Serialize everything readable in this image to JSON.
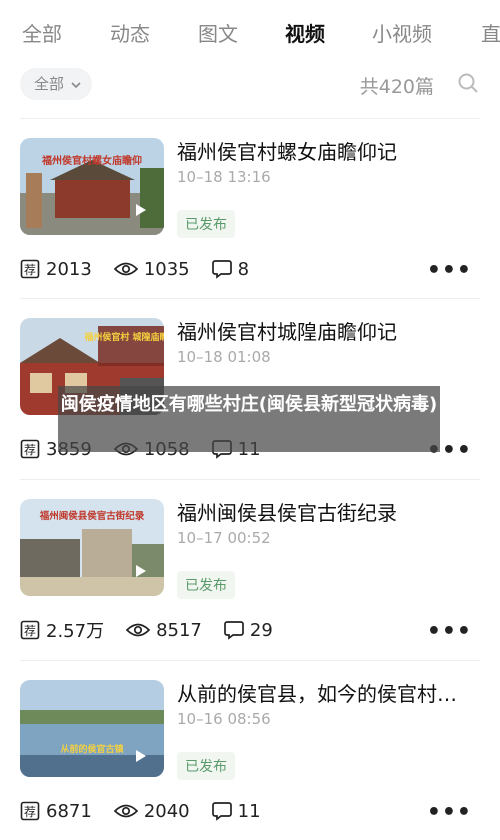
{
  "tabs": [
    {
      "label": "全部"
    },
    {
      "label": "动态"
    },
    {
      "label": "图文"
    },
    {
      "label": "视频"
    },
    {
      "label": "小视频"
    },
    {
      "label": "直"
    }
  ],
  "active_tab": "视频",
  "filter": {
    "label": "全部"
  },
  "total": {
    "label": "共420篇"
  },
  "videos": [
    {
      "title": "福州侯官村螺女庙瞻仰记",
      "date": "10–18 13:16",
      "badge": "已发布",
      "rec": "2013",
      "views": "1035",
      "comments": "8",
      "thumb_caption": "福州侯官村螺女庙瞻仰"
    },
    {
      "title": "福州侯官村城隍庙瞻仰记",
      "date": "10–18 01:08",
      "badge": "",
      "rec": "3859",
      "views": "1058",
      "comments": "11",
      "thumb_caption": "福州侯官村 城隍庙瞻仰"
    },
    {
      "title": "福州闽侯县侯官古街纪录",
      "date": "10–17 00:52",
      "badge": "已发布",
      "rec": "2.57万",
      "views": "8517",
      "comments": "29",
      "thumb_caption": "福州闽侯县侯官古街纪录"
    },
    {
      "title": "从前的侯官县，如今的侯官村…",
      "date": "10–16 08:56",
      "badge": "已发布",
      "rec": "6871",
      "views": "2040",
      "comments": "11",
      "thumb_caption": "从前的侯官古镇"
    }
  ],
  "overlay": {
    "text": "闽侯疫情地区有哪些村庄(闽侯县新型冠状病毒)"
  },
  "colors": {
    "active_tab": "#111111",
    "badge_text": "#5a9a6a",
    "muted": "#999999"
  }
}
